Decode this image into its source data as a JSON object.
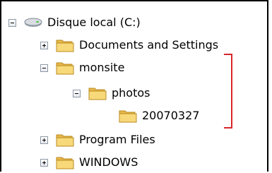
{
  "tree": {
    "drive": {
      "label": "Disque local (C:)",
      "state": "expanded",
      "icon": "hard-drive-icon"
    },
    "documents_and_settings": {
      "label": "Documents and Settings",
      "state": "collapsed",
      "icon": "folder-icon"
    },
    "monsite": {
      "label": "monsite",
      "state": "expanded",
      "icon": "folder-icon"
    },
    "photos": {
      "label": "photos",
      "state": "expanded",
      "icon": "folder-icon"
    },
    "folder_20070327": {
      "label": "20070327",
      "icon": "folder-icon"
    },
    "program_files": {
      "label": "Program Files",
      "state": "collapsed",
      "icon": "folder-icon"
    },
    "windows": {
      "label": "WINDOWS",
      "state": "collapsed",
      "icon": "folder-icon"
    }
  },
  "colors": {
    "folder": "#f5d76e",
    "highlight_bracket": "#d9262b"
  }
}
